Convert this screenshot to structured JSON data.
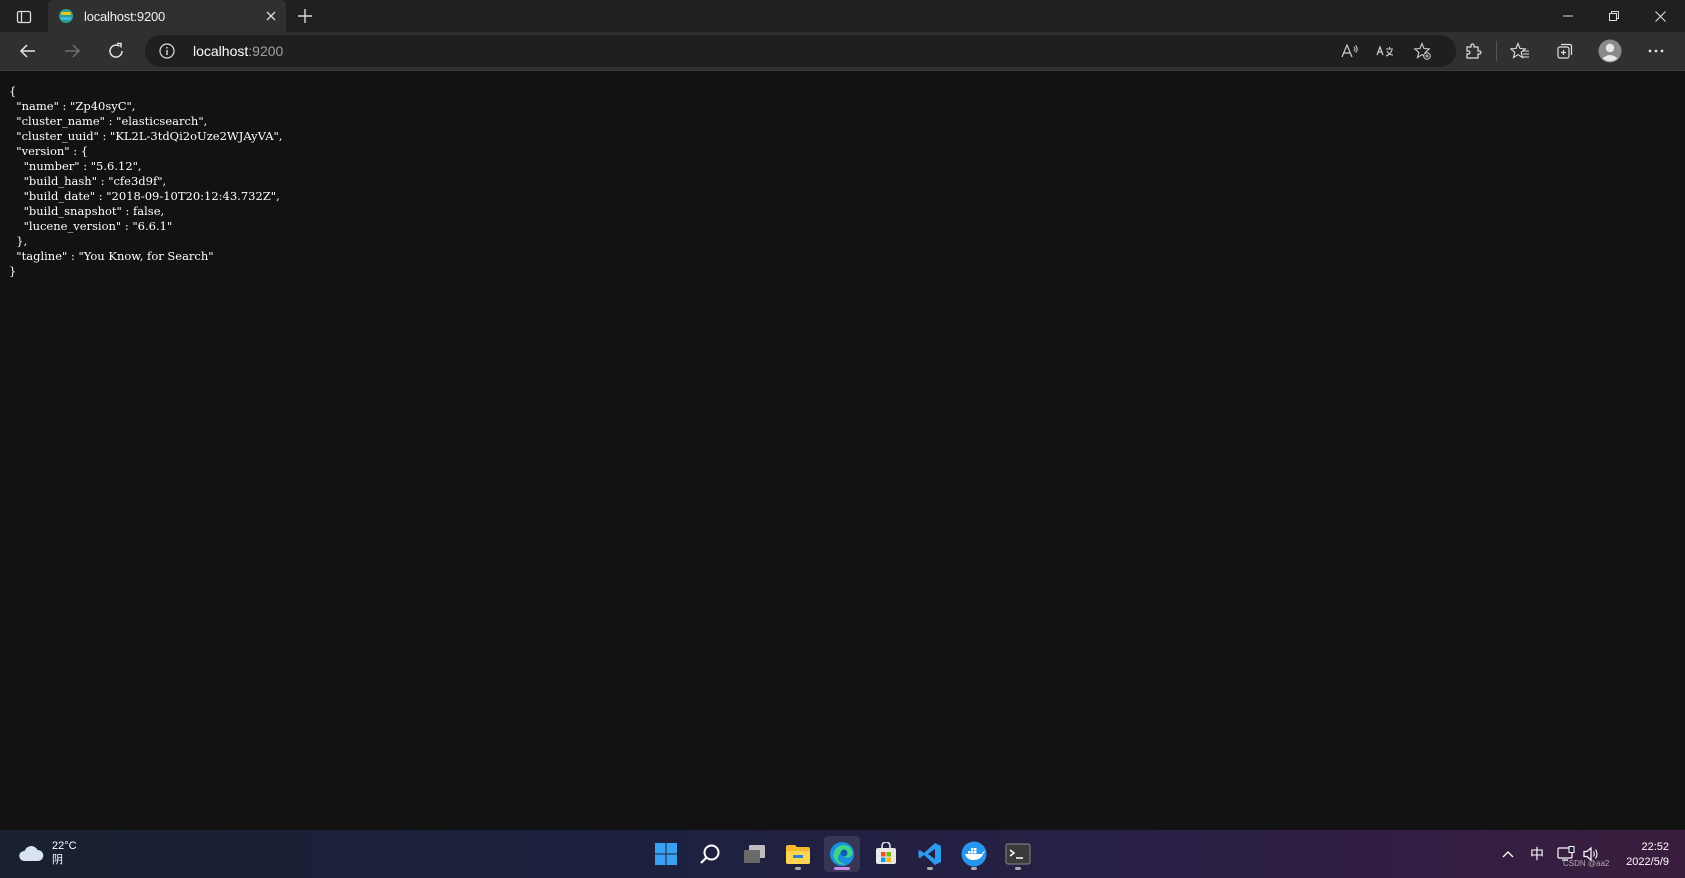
{
  "browser": {
    "tab": {
      "title": "localhost:9200"
    },
    "address": {
      "host": "localhost",
      "port": ":9200"
    }
  },
  "page": {
    "json_text": "{\n  \"name\" : \"Zp40syC\",\n  \"cluster_name\" : \"elasticsearch\",\n  \"cluster_uuid\" : \"KL2L-3tdQi2oUze2WJAyVA\",\n  \"version\" : {\n    \"number\" : \"5.6.12\",\n    \"build_hash\" : \"cfe3d9f\",\n    \"build_date\" : \"2018-09-10T20:12:43.732Z\",\n    \"build_snapshot\" : false,\n    \"lucene_version\" : \"6.6.1\"\n  },\n  \"tagline\" : \"You Know, for Search\"\n}"
  },
  "taskbar": {
    "weather": {
      "temp": "22°C",
      "condition": "阴"
    },
    "ime": "中",
    "clock": {
      "time": "22:52",
      "date": "2022/5/9"
    },
    "watermark": "CSDN @aa2"
  },
  "colors": {
    "accent_indicator": "#c78de8",
    "page_bg": "#121212",
    "toolbar_bg": "#303030"
  }
}
